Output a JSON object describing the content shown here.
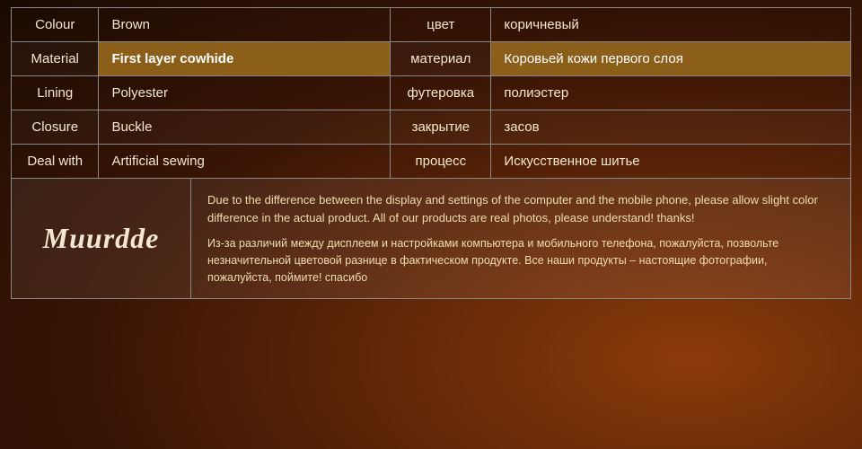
{
  "table": {
    "rows": [
      {
        "label_en": "Colour",
        "value_en": "Brown",
        "label_ru": "цвет",
        "value_ru": "коричневый",
        "highlighted": false
      },
      {
        "label_en": "Material",
        "value_en": "First layer cowhide",
        "label_ru": "материал",
        "value_ru": "Коровьей кожи первого слоя",
        "highlighted": true
      },
      {
        "label_en": "Lining",
        "value_en": "Polyester",
        "label_ru": "футеровка",
        "value_ru": "полиэстер",
        "highlighted": false
      },
      {
        "label_en": "Closure",
        "value_en": "Buckle",
        "label_ru": "закрытие",
        "value_ru": "засов",
        "highlighted": false
      },
      {
        "label_en": "Deal with",
        "value_en": "Artificial sewing",
        "label_ru": "процесс",
        "value_ru": "Искусственное шитье",
        "highlighted": false
      }
    ]
  },
  "logo": {
    "text": "Muurdde"
  },
  "disclaimer": {
    "en": "Due to the difference between the display and settings of the computer and the mobile phone, please allow slight color difference in the actual product. All of our products are real photos, please understand! thanks!",
    "ru": "Из-за различий между дисплеем и настройками компьютера и мобильного телефона, пожалуйста, позвольте незначительной цветовой разнице в фактическом продукте. Все наши продукты – настоящие фотографии, пожалуйста, поймите! спасибо"
  }
}
